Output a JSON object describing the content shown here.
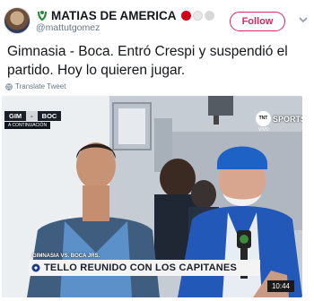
{
  "author": {
    "display_name": "MATIAS DE AMERICA",
    "handle": "@mattutgomez"
  },
  "follow_label": "Follow",
  "tweet": {
    "text": "Gimnasia - Boca. Entró Crespi y suspendió el partido. Hoy lo quieren jugar.",
    "translate_label": "Translate Tweet"
  },
  "media": {
    "scoreboard": {
      "home": "GIM",
      "away": "BOC",
      "score": "-",
      "subtitle": "A CONTINUACIÓN"
    },
    "broadcaster": {
      "tnt": "TNT",
      "sports": "SPORTS",
      "live": "VIVO"
    },
    "lower_third": {
      "match": "GIMNASIA VS. BOCA JRS.",
      "title": "TELLO REUNIDO CON LOS CAPITANES"
    },
    "clock": "10:44"
  },
  "colors": {
    "follow": "#e0245e",
    "flag_dots": [
      "#d0021b",
      "#e8e8e8",
      "#d0d0d0"
    ]
  }
}
